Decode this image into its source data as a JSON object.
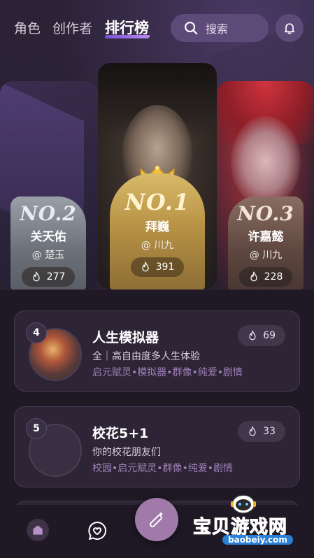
{
  "header": {
    "tabs": [
      {
        "label": "角色",
        "active": false
      },
      {
        "label": "创作者",
        "active": false
      },
      {
        "label": "排行榜",
        "active": true
      }
    ],
    "search_label": "搜索"
  },
  "podium": {
    "second": {
      "rank": "NO.2",
      "name": "关天佑",
      "author": "@ 楚玉",
      "hot": "277"
    },
    "first": {
      "rank": "NO.1",
      "name": "拜巍",
      "author": "@ 川九",
      "hot": "391"
    },
    "third": {
      "rank": "NO.3",
      "name": "许嘉懿",
      "author": "@ 川九",
      "hot": "228"
    }
  },
  "list": [
    {
      "rank": "4",
      "title": "人生模拟器",
      "desc": "全｜高自由度多人生体验",
      "tags": "启元赋灵•模拟器•群像•纯爱•剧情",
      "hot": "69"
    },
    {
      "rank": "5",
      "title": "校花5+1",
      "desc": "你的校花朋友们",
      "tags": "校园•启元赋灵•群像•纯爱•剧情",
      "hot": "33"
    }
  ],
  "watermark": {
    "text": "宝贝游戏网",
    "url": "baobeiy.com"
  },
  "colors": {
    "accent": "#7b4fd6",
    "gold": "#c9a555",
    "silver": "#8d929a",
    "bronze": "#6e5248",
    "tag": "#a07fb8"
  },
  "icons": {
    "search": "search-icon",
    "bell": "bell-icon",
    "flame": "flame-icon",
    "crown": "crown-icon",
    "home": "home-icon",
    "chat": "chat-heart-icon",
    "create": "magic-wand-icon"
  }
}
